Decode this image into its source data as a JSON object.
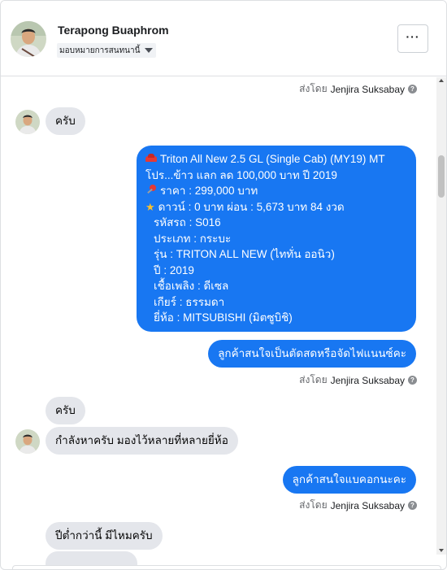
{
  "header": {
    "name": "Terapong Buaphrom",
    "assign_label": "มอบหมายการสนทนานี้",
    "more_label": "···"
  },
  "sent_by": {
    "prefix": "ส่งโดย",
    "agent": "Jenjira Suksabay"
  },
  "messages": {
    "m1": "ครับ",
    "ad": {
      "line1": "Triton All New 2.5 GL (Single Cab) (MY19) MT",
      "line2": "โปร...ข้าว แลก ลด 100,000 บาท ปี 2019",
      "price": "ราคา : 299,000 บาท",
      "down": "ดาวน์ : 0 บาท ผ่อน : 5,673 บาท 84 งวด",
      "code": "รหัสรถ : S016",
      "type": "ประเภท : กระบะ",
      "model": "รุ่น : TRITON ALL NEW (ไททั่น ออนิว)",
      "year": "ปี : 2019",
      "fuel": "เชื้อเพลิง : ดีเซล",
      "gear": "เกียร์ : ธรรมดา",
      "brand": "ยี่ห้อ : MITSUBISHI (มิตซูบิชิ)"
    },
    "m3": "ลูกค้าสนใจเป็นตัดสดหรือจัดไฟแนนซ์คะ",
    "m4": "ครับ",
    "m5": "กำลังหาครับ มองไว้หลายที่หลายยี่ห้อ",
    "m6": "ลูกค้าสนใจแบคอกนะคะ",
    "m7": "ปีต่ำกว่านี้ มีไหมครับ"
  },
  "colors": {
    "outgoing": "#1877f2",
    "incoming": "#e4e6eb"
  }
}
